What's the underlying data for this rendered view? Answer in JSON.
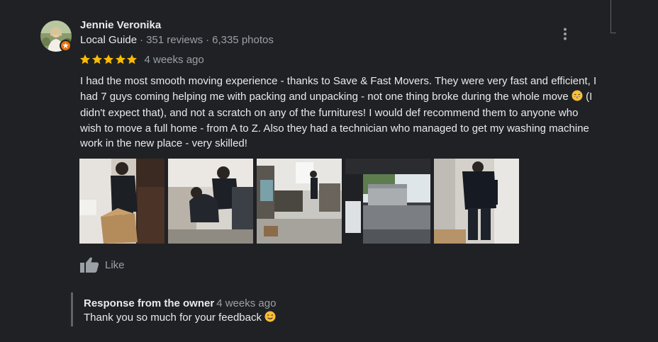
{
  "reviewer": {
    "name": "Jennie Veronika",
    "level": "Local Guide",
    "reviews": "351 reviews",
    "photos": "6,335 photos"
  },
  "review": {
    "rating": 5,
    "date": "4 weeks ago",
    "text_part1": "I had the most smooth moving experience - thanks to Save & Fast Movers. They were very fast and efficient, I had 7 guys coming helping me with packing and unpacking - not one thing broke during the whole move",
    "text_part2": "(I didn't expect that), and not a scratch on any of the furnitures! I would def recommend them to anyone who wish to move a full home - from A to Z. Also they had a technician who managed to get my washing machine work in the new place - very skilled!",
    "emoji_name": "grinning-sweat-emoji"
  },
  "photos": [
    {
      "name": "photo-mover-with-boxes"
    },
    {
      "name": "photo-movers-lifting-furniture"
    },
    {
      "name": "photo-room-with-items"
    },
    {
      "name": "photo-moving-truck"
    },
    {
      "name": "photo-mover-outside"
    }
  ],
  "actions": {
    "like_label": "Like"
  },
  "owner_response": {
    "title": "Response from the owner",
    "date": "4 weeks ago",
    "text": "Thank you so much for your feedback",
    "emoji_name": "smiling-emoji"
  },
  "colors": {
    "background": "#202124",
    "text": "#e8eaed",
    "muted": "#9aa0a6",
    "star": "#fbbc04",
    "badge": "#e8710a"
  }
}
